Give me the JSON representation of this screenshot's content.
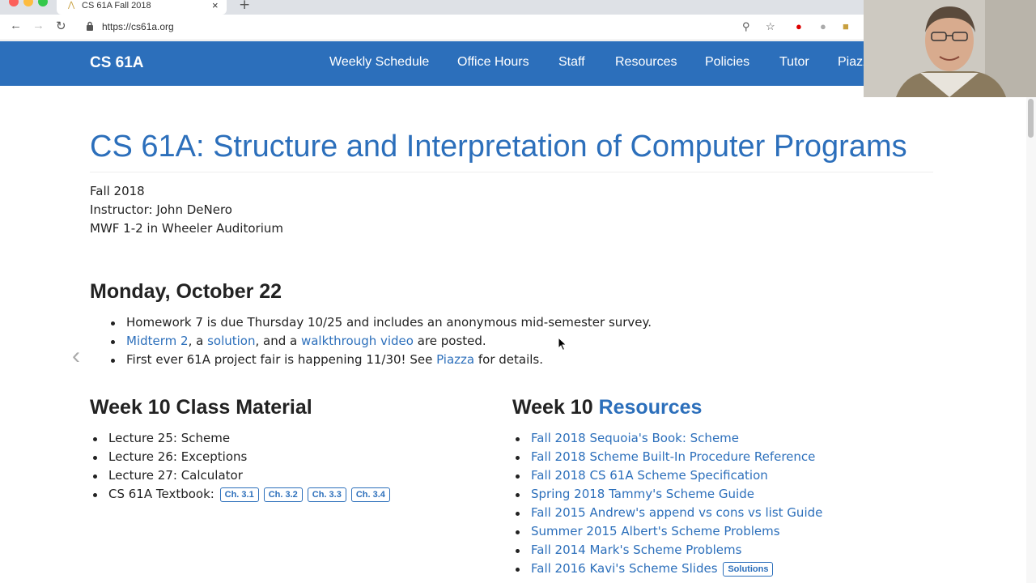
{
  "browser": {
    "tab_title": "CS 61A Fall 2018",
    "url": "https://cs61a.org"
  },
  "site": {
    "brand": "CS 61A",
    "nav": [
      "Weekly Schedule",
      "Office Hours",
      "Staff",
      "Resources",
      "Policies",
      "Tutor",
      "Piazza"
    ]
  },
  "page": {
    "title": "CS 61A: Structure and Interpretation of Computer Programs",
    "term": "Fall 2018",
    "instructor": "Instructor: John DeNero",
    "schedule": "MWF 1-2 in Wheeler Auditorium"
  },
  "announcements": {
    "heading": "Monday, October 22",
    "item1": "Homework 7 is due Thursday 10/25 and includes an anonymous mid-semester survey.",
    "item2": {
      "link1": "Midterm 2",
      "t1": ", a ",
      "link2": "solution",
      "t2": ", and a ",
      "link3": "walkthrough video",
      "t3": " are posted."
    },
    "item3": {
      "t1": "First ever 61A project fair is happening 11/30! See ",
      "link": "Piazza",
      "t2": " for details."
    }
  },
  "class_material": {
    "heading": "Week 10 Class Material",
    "lectures": [
      "Lecture 25: Scheme",
      "Lecture 26: Exceptions",
      "Lecture 27: Calculator"
    ],
    "textbook_label": "CS 61A Textbook:",
    "chapters": [
      "Ch. 3.1",
      "Ch. 3.2",
      "Ch. 3.3",
      "Ch. 3.4"
    ]
  },
  "resources": {
    "heading_prefix": "Week 10 ",
    "heading_link": "Resources",
    "items": [
      "Fall 2018 Sequoia's Book: Scheme",
      "Fall 2018 Scheme Built-In Procedure Reference",
      "Fall 2018 CS 61A Scheme Specification",
      "Spring 2018 Tammy's Scheme Guide",
      "Fall 2015 Andrew's append vs cons vs list Guide",
      "Summer 2015 Albert's Scheme Problems",
      "Fall 2014 Mark's Scheme Problems",
      "Fall 2016 Kavi's Scheme Slides"
    ],
    "solutions_badge": "Solutions"
  },
  "colors": {
    "header_blue": "#2c6fbb",
    "link_blue": "#2c6fbb"
  }
}
